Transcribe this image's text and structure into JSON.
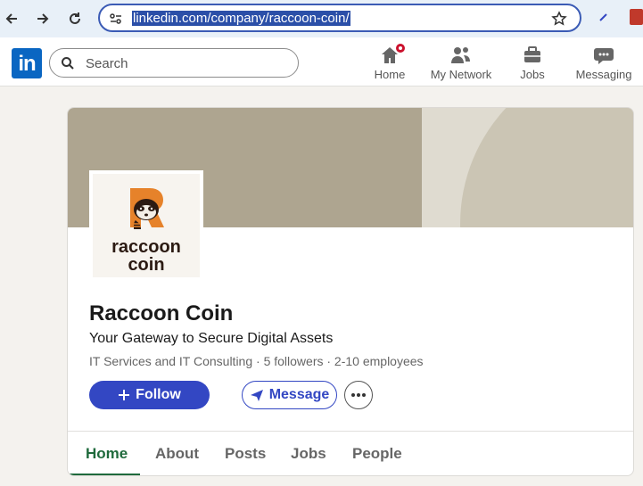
{
  "browser": {
    "url": "linkedin.com/company/raccoon-coin/"
  },
  "header": {
    "logo": "in",
    "search_placeholder": "Search",
    "nav": [
      {
        "label": "Home",
        "icon": "home-icon"
      },
      {
        "label": "My Network",
        "icon": "network-icon"
      },
      {
        "label": "Jobs",
        "icon": "briefcase-icon"
      },
      {
        "label": "Messaging",
        "icon": "chat-icon"
      }
    ]
  },
  "company": {
    "logo_text_line1": "raccoon",
    "logo_text_line2": "coin",
    "name": "Raccoon Coin",
    "tagline": "Your Gateway to Secure Digital Assets",
    "meta": "IT Services and IT Consulting · 5 followers · 2-10 employees",
    "follow_label": "Follow",
    "message_label": "Message"
  },
  "tabs": [
    "Home",
    "About",
    "Posts",
    "Jobs",
    "People"
  ],
  "colors": {
    "brand_blue": "#0a66c2",
    "button_blue": "#3347c3",
    "active_tab": "#1f6a3c",
    "notification_red": "#cb112d"
  }
}
